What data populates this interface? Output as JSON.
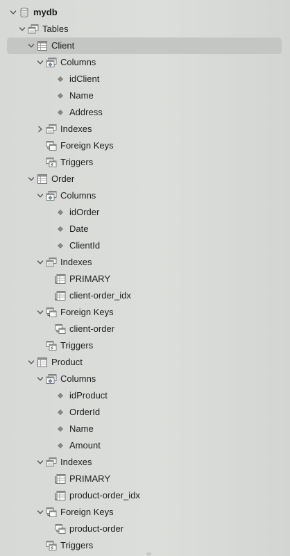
{
  "tree": {
    "db_name": "mydb",
    "tables_label": "Tables",
    "client": {
      "name": "Client",
      "columns_label": "Columns",
      "columns": [
        "idClient",
        "Name",
        "Address"
      ],
      "indexes_label": "Indexes",
      "foreign_keys_label": "Foreign Keys",
      "triggers_label": "Triggers"
    },
    "order": {
      "name": "Order",
      "columns_label": "Columns",
      "columns": [
        "idOrder",
        "Date",
        "ClientId"
      ],
      "indexes_label": "Indexes",
      "indexes": [
        "PRIMARY",
        "client-order_idx"
      ],
      "foreign_keys_label": "Foreign Keys",
      "foreign_keys": [
        "client-order"
      ],
      "triggers_label": "Triggers"
    },
    "product": {
      "name": "Product",
      "columns_label": "Columns",
      "columns": [
        "idProduct",
        "OrderId",
        "Name",
        "Amount"
      ],
      "indexes_label": "Indexes",
      "indexes": [
        "PRIMARY",
        "product-order_idx"
      ],
      "foreign_keys_label": "Foreign Keys",
      "foreign_keys": [
        "product-order"
      ],
      "triggers_label": "Triggers"
    }
  }
}
